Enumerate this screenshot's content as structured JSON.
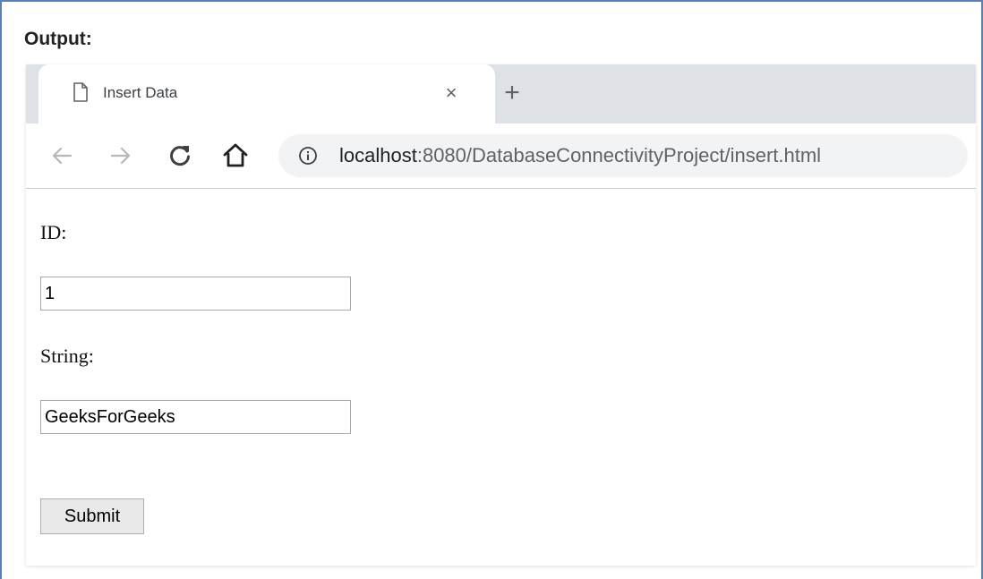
{
  "heading": "Output:",
  "browser": {
    "tab": {
      "title": "Insert Data",
      "page_icon": "document-icon",
      "close_icon": "close-icon",
      "close_glyph": "×"
    },
    "new_tab": {
      "icon": "plus-icon",
      "glyph": "+"
    },
    "toolbar": {
      "back_icon": "arrow-left-icon",
      "forward_icon": "arrow-right-icon",
      "reload_icon": "reload-icon",
      "home_icon": "home-icon",
      "info_icon": "info-icon"
    },
    "address": {
      "host": "localhost",
      "rest": ":8080/DatabaseConnectivityProject/insert.html"
    }
  },
  "form": {
    "id_label": "ID:",
    "id_value": "1",
    "string_label": "String:",
    "string_value": "GeeksForGeeks",
    "submit_label": "Submit"
  },
  "colors": {
    "frame_border": "#5b7fb6",
    "tab_strip": "#dee1e6",
    "omnibox": "#f1f3f4",
    "icon_gray": "#5f6368",
    "icon_dark": "#202124"
  }
}
